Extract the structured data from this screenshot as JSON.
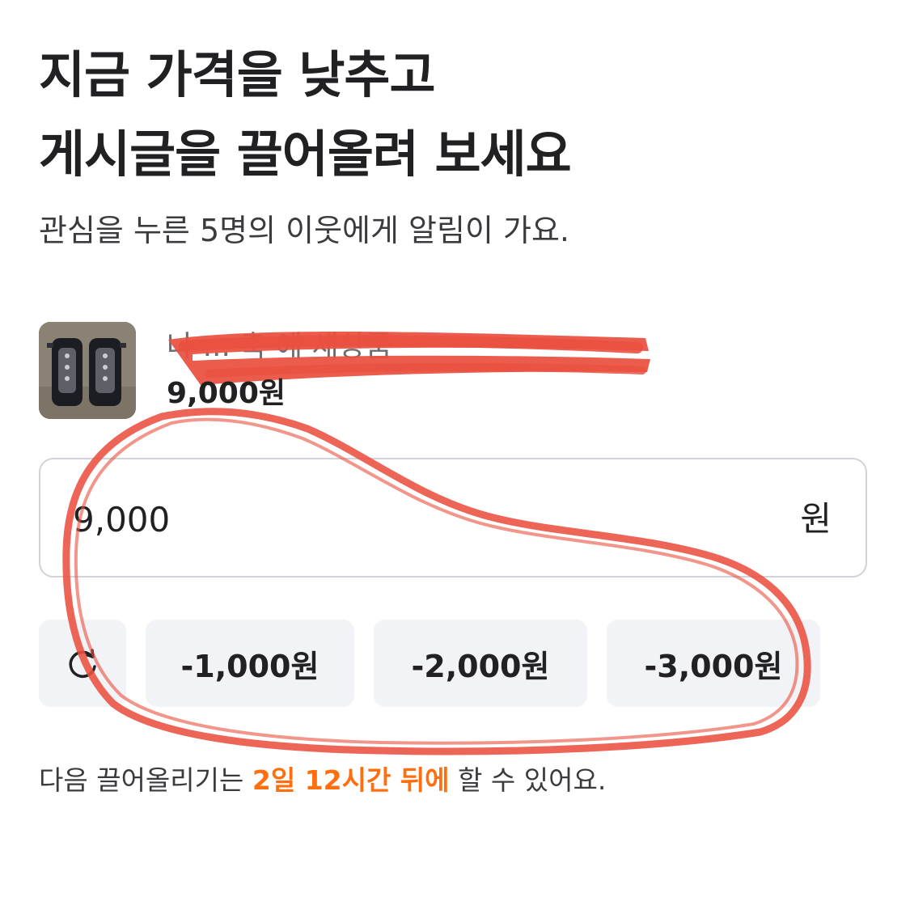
{
  "header": {
    "title_line1": "지금 가격을 낮추고",
    "title_line2": "게시글을 끌어올려 보세요",
    "subtitle": "관심을 누른 5명의 이웃에게 알림이 가요."
  },
  "product": {
    "thumbnail_icon": "shin-guards-photo",
    "name": "나 ... 축 에 새상품",
    "price": "9,000원"
  },
  "price_field": {
    "value": "9,000",
    "unit": "원"
  },
  "buttons": {
    "reset_icon": "reset-icon",
    "minus_1000": "-1,000원",
    "minus_2000": "-2,000원",
    "minus_3000": "-3,000원"
  },
  "note": {
    "before": "다음 끌어올리기는 ",
    "highlight": "2일 12시간 뒤에",
    "after": " 할 수 있어요."
  },
  "colors": {
    "accent": "#ff6f0f",
    "annotation": "#ea5040",
    "button_bg": "#f2f3f6",
    "field_border": "#d1d3d8"
  }
}
